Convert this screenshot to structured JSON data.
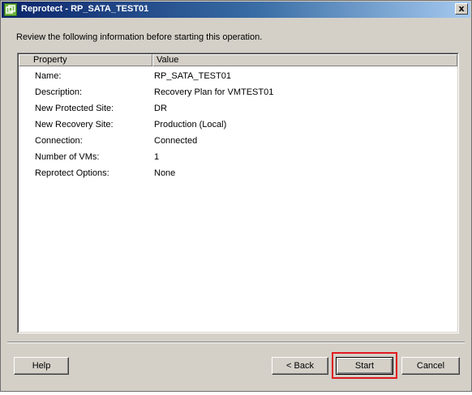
{
  "window": {
    "title": "Reprotect - RP_SATA_TEST01",
    "app_icon": "vmware-icon",
    "close_label": "x"
  },
  "instruction": "Review the following information before starting this operation.",
  "table": {
    "headers": [
      "Property",
      "Value"
    ],
    "rows": [
      {
        "property": "Name:",
        "value": "RP_SATA_TEST01"
      },
      {
        "property": "Description:",
        "value": "Recovery Plan for VMTEST01"
      },
      {
        "property": "New Protected Site:",
        "value": "DR"
      },
      {
        "property": "New Recovery Site:",
        "value": "Production (Local)"
      },
      {
        "property": "Connection:",
        "value": "Connected"
      },
      {
        "property": "Number of VMs:",
        "value": "1"
      },
      {
        "property": "Reprotect Options:",
        "value": "None"
      }
    ]
  },
  "buttons": {
    "help": "Help",
    "back": "< Back",
    "start": "Start",
    "cancel": "Cancel"
  },
  "colors": {
    "highlight": "#e0191f",
    "titlebar_start": "#0a246a"
  }
}
